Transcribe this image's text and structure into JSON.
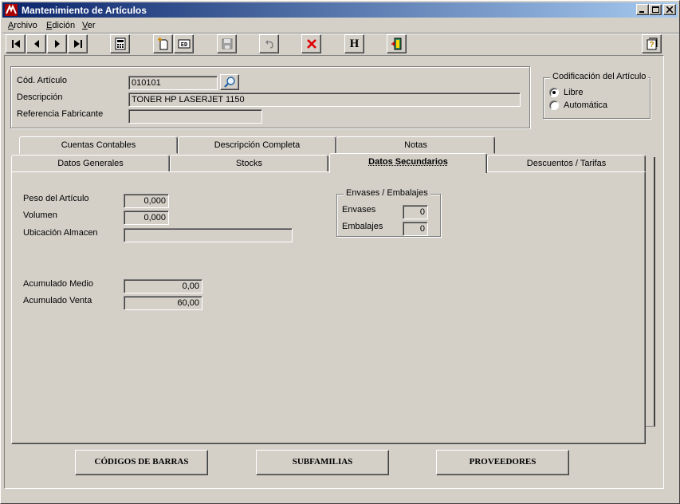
{
  "window": {
    "title": "Mantenimiento de Artículos"
  },
  "menu": {
    "items": [
      {
        "underline": "A",
        "rest": "rchivo"
      },
      {
        "underline": "E",
        "rest": "dición"
      },
      {
        "underline": "V",
        "rest": "er"
      }
    ]
  },
  "toolbar": {
    "icons": [
      "first-record-icon",
      "previous-record-icon",
      "next-record-icon",
      "last-record-icon",
      "calculator-icon",
      "new-document-icon",
      "edit-icon",
      "save-disk-icon",
      "undo-icon",
      "delete-x-icon",
      "h-letter-icon",
      "exit-door-icon",
      "help-icon"
    ],
    "h_label": "H"
  },
  "header": {
    "cod_label": "Cód. Artículo",
    "cod_value": "010101",
    "desc_label": "Descripción",
    "desc_value": "TONER HP LASERJET 1150",
    "ref_label": "Referencia Fabricante",
    "ref_value": ""
  },
  "codificacion": {
    "title": "Codificación del Artículo",
    "options": [
      {
        "label": "Libre",
        "selected": true
      },
      {
        "label": "Automática",
        "selected": false
      }
    ]
  },
  "tabs": {
    "back_row": [
      "Cuentas Contables",
      "Descripción Completa",
      "Notas"
    ],
    "front_row": [
      "Datos Generales",
      "Stocks",
      "Datos Secundarios",
      "Descuentos / Tarifas"
    ],
    "active": "Datos Secundarios"
  },
  "secundarios": {
    "peso_label": "Peso del Artículo",
    "peso_value": "0,000",
    "volumen_label": "Volumen",
    "volumen_value": "0,000",
    "ubicacion_label": "Ubicación Almacen",
    "ubicacion_value": "",
    "acum_medio_label": "Acumulado Medio",
    "acum_medio_value": "0,00",
    "acum_venta_label": "Acumulado Venta",
    "acum_venta_value": "60,00"
  },
  "envases": {
    "title": "Envases / Embalajes",
    "envases_label": "Envases",
    "envases_value": "0",
    "embalajes_label": "Embalajes",
    "embalajes_value": "0"
  },
  "buttons": {
    "codigos": "CÓDIGOS DE BARRAS",
    "subfamilias": "SUBFAMILIAS",
    "proveedores": "PROVEEDORES"
  },
  "colors": {
    "titlebar_start": "#0a246a",
    "titlebar_end": "#a6caf0",
    "face": "#d4d0c8",
    "delete_red": "#e00000"
  }
}
